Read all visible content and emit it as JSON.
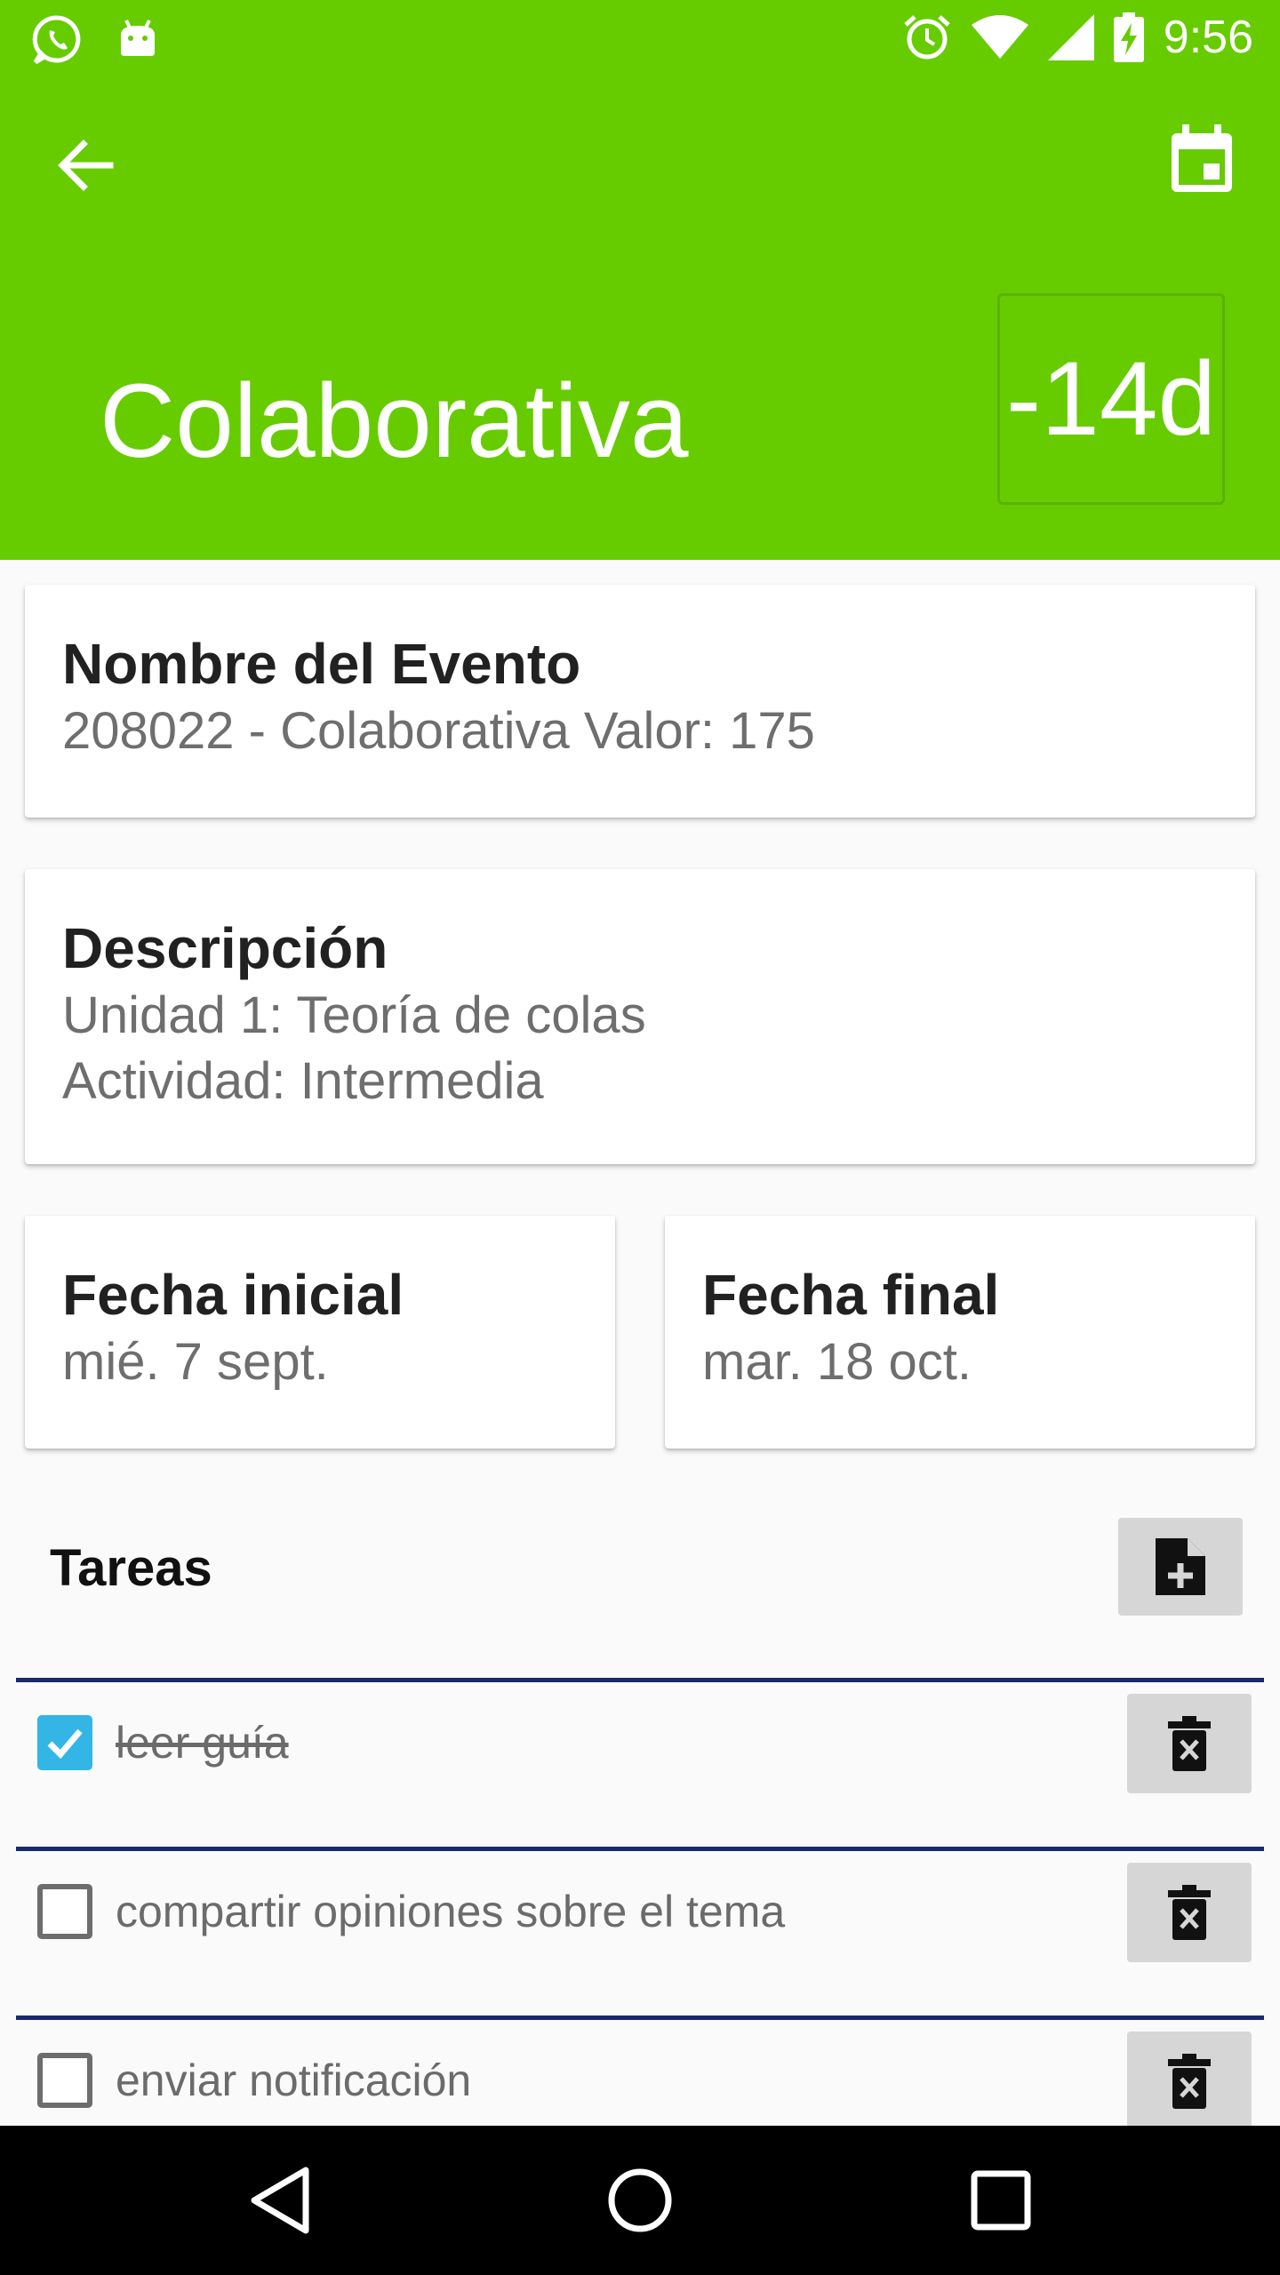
{
  "status_bar": {
    "time": "9:56",
    "icons_left": [
      "whatsapp-icon",
      "android-icon"
    ],
    "icons_right": [
      "alarm-icon",
      "wifi-icon",
      "signal-icon",
      "battery-charging-icon"
    ]
  },
  "app_bar": {
    "back_icon": "arrow-back-icon",
    "calendar_icon": "calendar-icon",
    "title": "Colaborativa",
    "days_remaining": "-14d",
    "background_color": "#66cc00"
  },
  "event_name": {
    "title": "Nombre del Evento",
    "value": "208022 - Colaborativa Valor: 175"
  },
  "description": {
    "title": "Descripción",
    "line1": "Unidad 1: Teoría de colas",
    "line2": "Actividad: Intermedia"
  },
  "start_date": {
    "title": "Fecha inicial",
    "value": "mié. 7 sept."
  },
  "end_date": {
    "title": "Fecha final",
    "value": "mar. 18 oct."
  },
  "tasks": {
    "header": "Tareas",
    "add_icon": "note-add-icon",
    "delete_icon": "delete-icon",
    "checkbox_color": "#33b5e5",
    "rule_color": "#1b2a6b",
    "items": [
      {
        "label": "leer guía ",
        "checked": true
      },
      {
        "label": "compartir opiniones sobre el tema",
        "checked": false
      },
      {
        "label": "enviar notificación",
        "checked": false
      }
    ]
  },
  "nav_bar": {
    "buttons": [
      "back-triangle-icon",
      "home-circle-icon",
      "recents-square-icon"
    ]
  }
}
